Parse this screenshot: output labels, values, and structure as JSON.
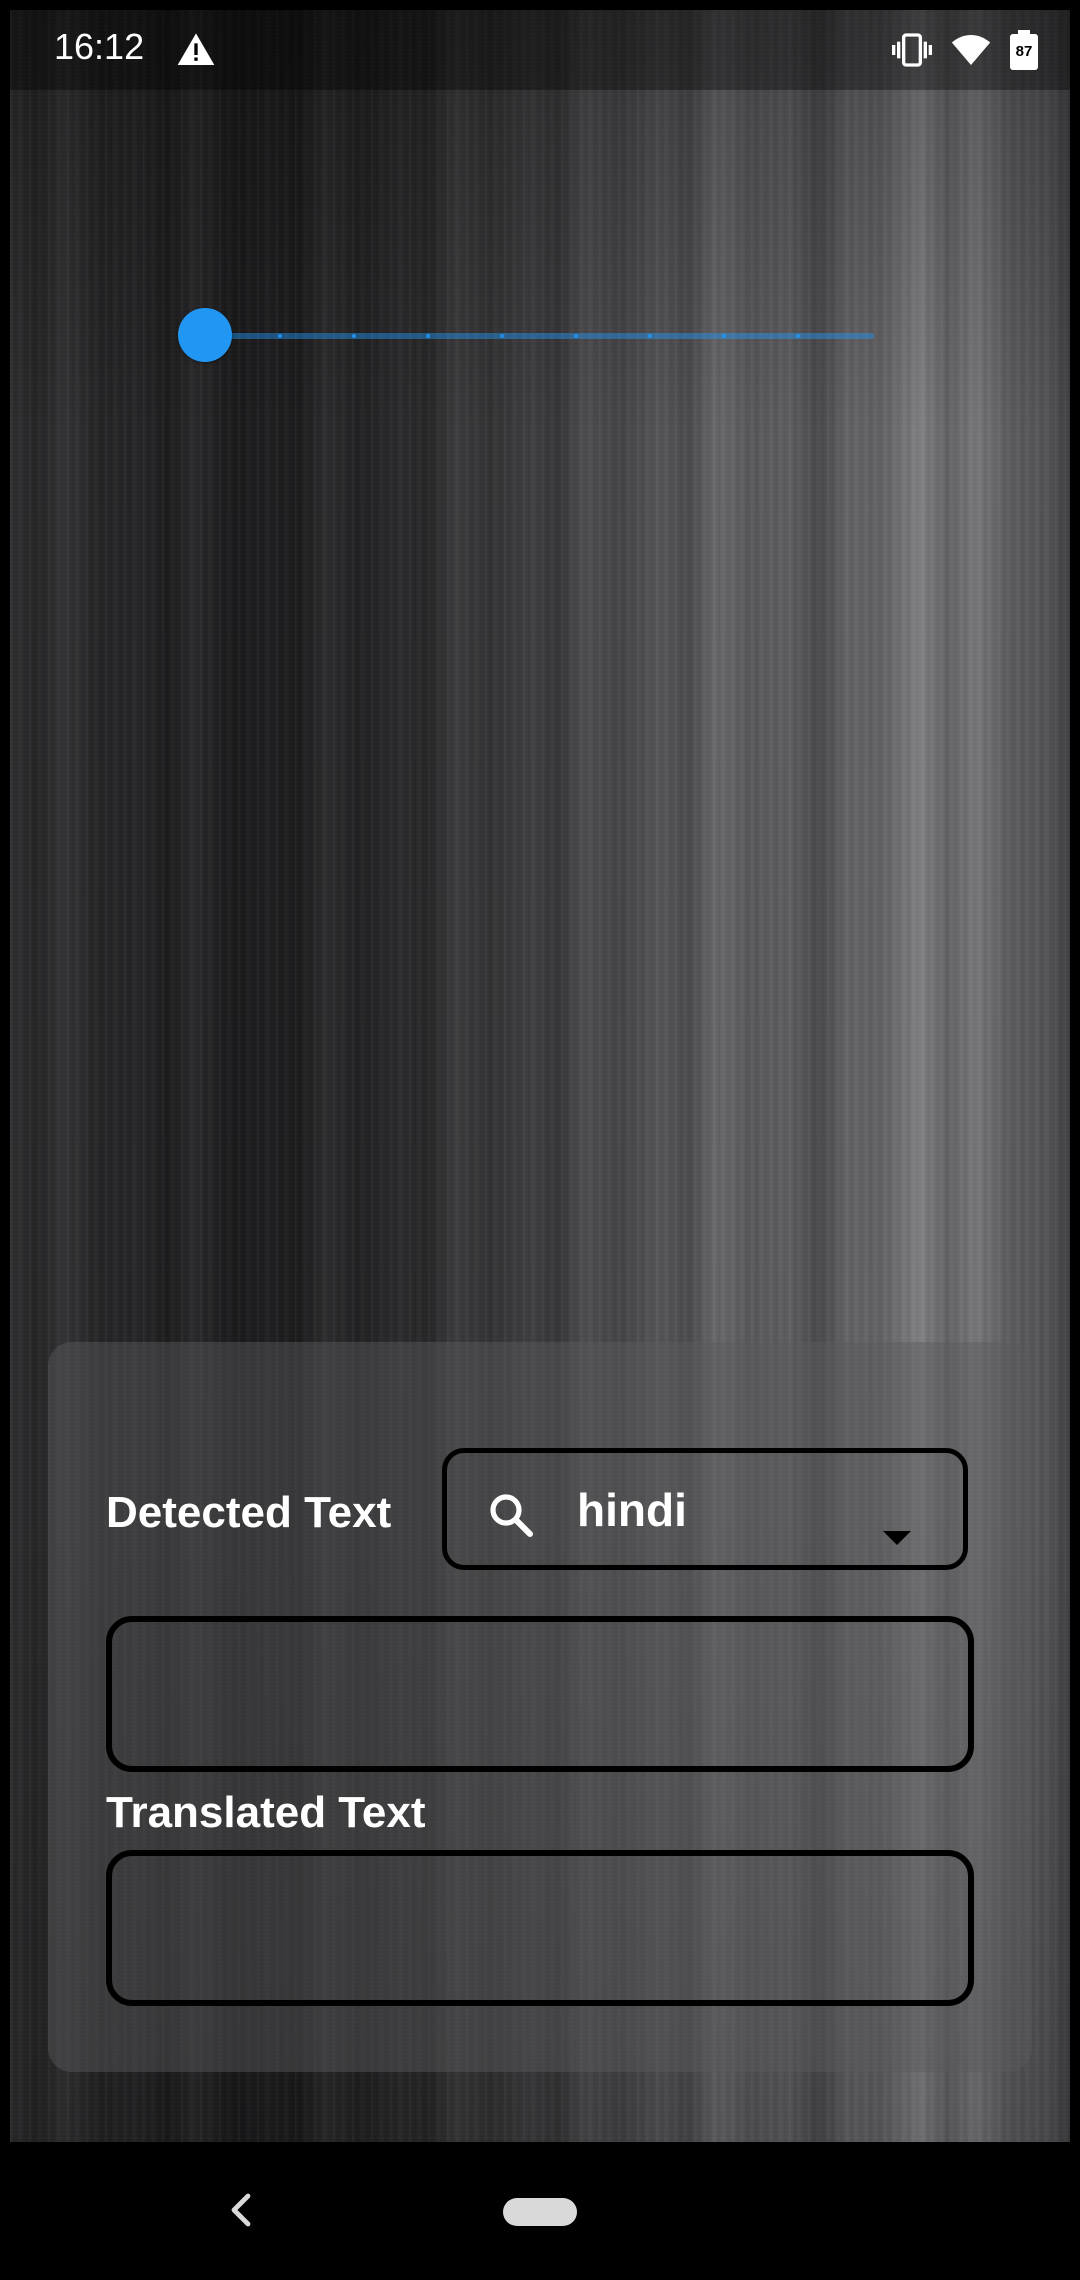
{
  "status_bar": {
    "time": "16:12",
    "battery_level": "87",
    "icons": [
      "warning-icon",
      "vibrate-icon",
      "wifi-icon",
      "battery-icon"
    ]
  },
  "slider": {
    "value": 0.0
  },
  "panel": {
    "detected_label": "Detected Text",
    "language_value": "hindi",
    "detected_text": "",
    "translated_label": "Translated Text",
    "translated_text": ""
  },
  "colors": {
    "accent": "#2196f3",
    "panel_bg": "#5a5a5e",
    "text": "#ffffff"
  }
}
